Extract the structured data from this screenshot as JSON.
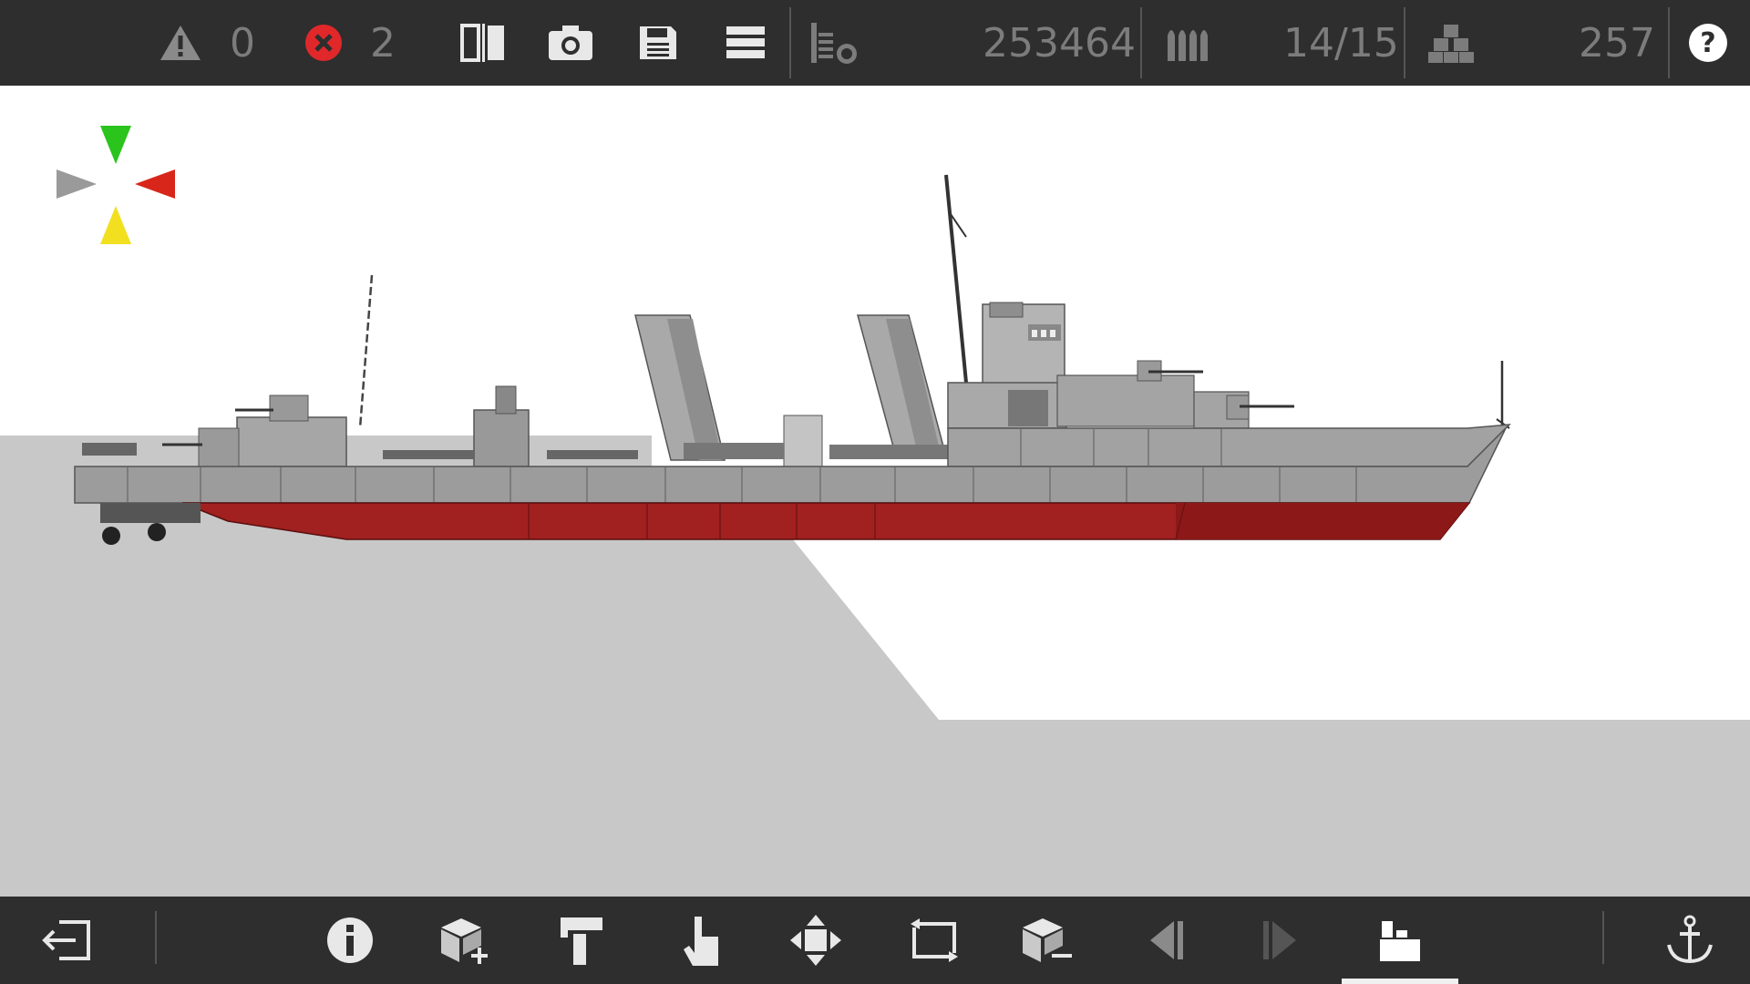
{
  "top_bar": {
    "warnings_count": "0",
    "errors_count": "2",
    "cost": "253464",
    "ammo": "14/15",
    "blocks": "257",
    "icons": [
      "warning-icon",
      "error-icon",
      "mirror-icon",
      "camera-icon",
      "save-icon",
      "menu-icon",
      "layers-icon",
      "ammo-icon",
      "blocks-icon",
      "help-icon"
    ]
  },
  "bottom_bar": {
    "icons": [
      "exit-icon",
      "info-icon",
      "add-block-icon",
      "paint-roller-icon",
      "hand-icon",
      "move-icon",
      "rotate-icon",
      "remove-block-icon",
      "previous-icon",
      "next-icon",
      "blocks-layer-icon",
      "anchor-icon"
    ]
  },
  "colors": {
    "toolbar_bg": "#2e2e2e",
    "icon_gray": "#7c7c7c",
    "icon_white": "#e8e8e8",
    "error_red": "#e0282a",
    "hull_gray": "#9a9a9a",
    "hull_red": "#a12020",
    "compass_green": "#2bc41c",
    "compass_red": "#d8261a",
    "compass_yellow": "#f2e020",
    "compass_gray": "#9a9a9a"
  }
}
